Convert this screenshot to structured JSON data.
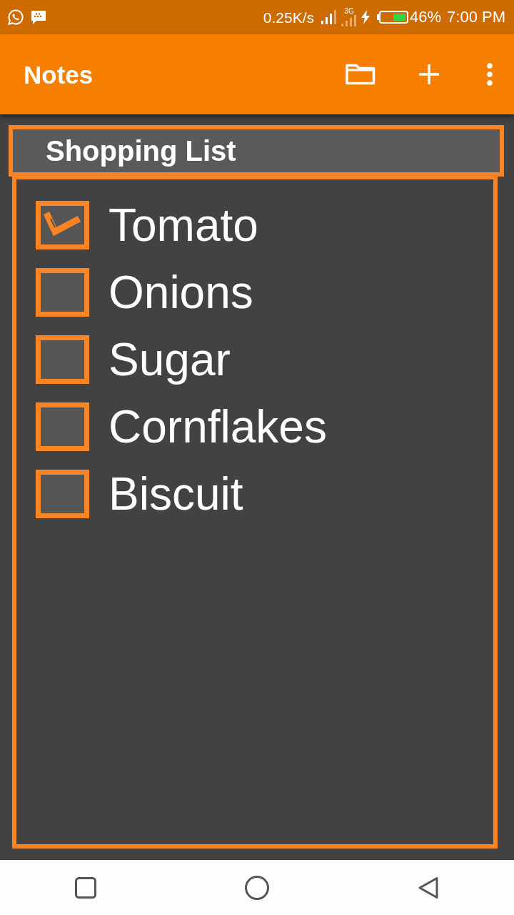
{
  "status_bar": {
    "network_speed": "0.25K/s",
    "network_type": "3G",
    "battery": "46%",
    "time": "7:00 PM"
  },
  "app_bar": {
    "title": "Notes"
  },
  "note": {
    "title": "Shopping List",
    "items": [
      {
        "label": "Tomato",
        "checked": true
      },
      {
        "label": "Onions",
        "checked": false
      },
      {
        "label": "Sugar",
        "checked": false
      },
      {
        "label": "Cornflakes",
        "checked": false
      },
      {
        "label": "Biscuit",
        "checked": false
      }
    ]
  }
}
